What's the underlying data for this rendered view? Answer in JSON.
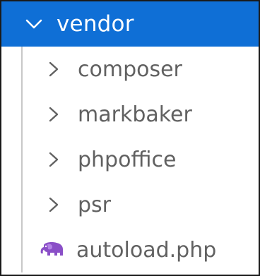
{
  "folder": {
    "name": "vendor",
    "expanded": true,
    "icon": "chevron-down-icon",
    "highlight_color": "#0f6fd6"
  },
  "children": [
    {
      "label": "composer",
      "type": "folder",
      "icon": "chevron-right-icon"
    },
    {
      "label": "markbaker",
      "type": "folder",
      "icon": "chevron-right-icon"
    },
    {
      "label": "phpoffice",
      "type": "folder",
      "icon": "chevron-right-icon"
    },
    {
      "label": "psr",
      "type": "folder",
      "icon": "chevron-right-icon"
    },
    {
      "label": "autoload.php",
      "type": "file",
      "icon": "php-elephant-icon",
      "icon_color": "#8a4fc7"
    }
  ]
}
